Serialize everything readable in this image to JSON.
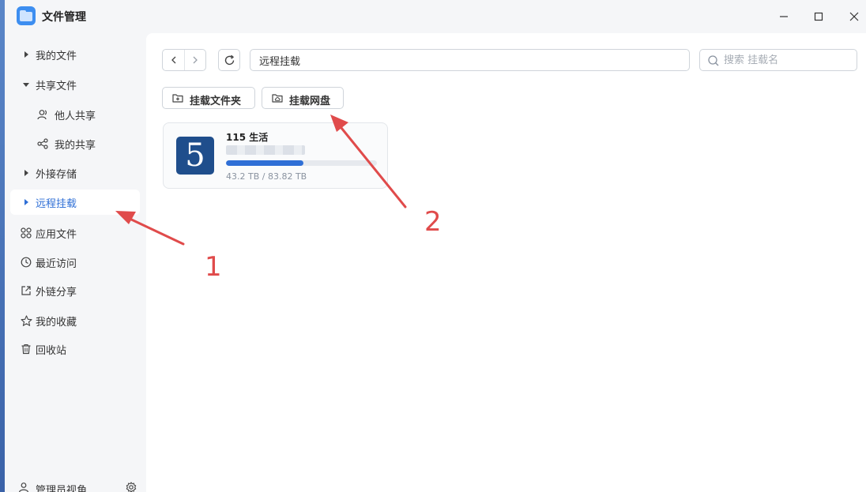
{
  "app": {
    "title": "文件管理",
    "icon": "folder-app-icon"
  },
  "window_controls": [
    "minimize-icon",
    "maximize-icon",
    "close-icon"
  ],
  "sidebar": {
    "items": [
      {
        "label": "我的文件",
        "icon": "caret-right-icon",
        "active": false
      },
      {
        "label": "共享文件",
        "icon": "caret-down-icon",
        "active": false
      },
      {
        "label": "他人共享",
        "icon": "user-icon",
        "active": false,
        "sub": true
      },
      {
        "label": "我的共享",
        "icon": "share-icon",
        "active": false,
        "sub": true
      },
      {
        "label": "外接存储",
        "icon": "caret-right-icon",
        "active": false
      },
      {
        "label": "远程挂载",
        "icon": "caret-right-icon",
        "active": true
      },
      {
        "label": "应用文件",
        "icon": "apps-grid-icon",
        "active": false
      },
      {
        "label": "最近访问",
        "icon": "clock-icon",
        "active": false
      },
      {
        "label": "外链分享",
        "icon": "external-link-icon",
        "active": false
      },
      {
        "label": "我的收藏",
        "icon": "star-icon",
        "active": false
      },
      {
        "label": "回收站",
        "icon": "trash-icon",
        "active": false
      }
    ],
    "footer": {
      "label": "管理员视角",
      "icon": "admin-user-icon",
      "settings_icon": "gear-icon"
    }
  },
  "toolbar": {
    "path": "远程挂载",
    "search_placeholder": "搜索 挂载名",
    "mount_folder_label": "挂载文件夹",
    "mount_drive_label": "挂载网盘"
  },
  "mounts": [
    {
      "logo_text": "5",
      "name": "115 生活",
      "used": "43.2 TB",
      "total": "83.82 TB",
      "usage_text": "43.2 TB / 83.82 TB",
      "used_fraction": 0.515
    }
  ],
  "annotations": [
    {
      "label": "1"
    },
    {
      "label": "2"
    }
  ],
  "colors": {
    "accent": "#2f6fd6",
    "annotation": "#e04b4b",
    "logo_bg": "#1f4e8c"
  }
}
